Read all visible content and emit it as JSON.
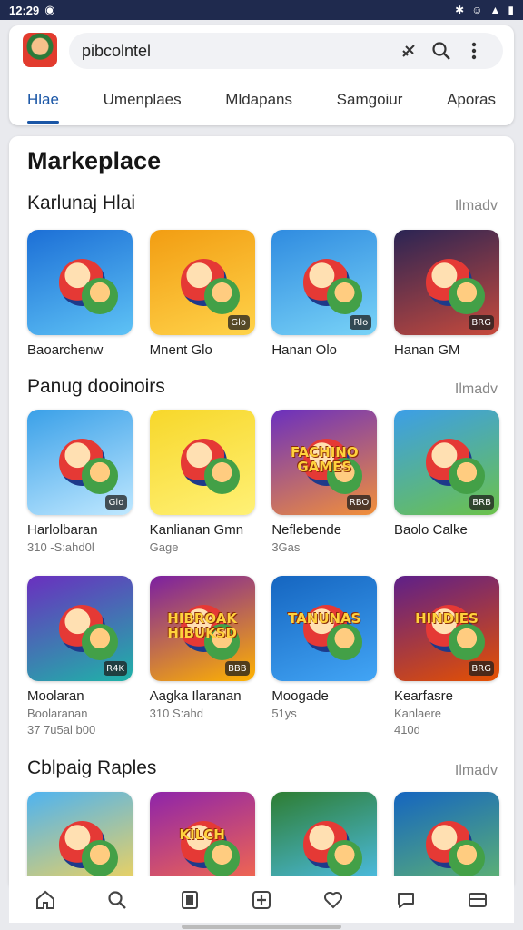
{
  "status": {
    "time": "12:29"
  },
  "search": {
    "query": "pibcolntel"
  },
  "tabs": [
    {
      "label": "Hlae",
      "active": true
    },
    {
      "label": "Umenplaes",
      "active": false
    },
    {
      "label": "Mldapans",
      "active": false
    },
    {
      "label": "Samgoiur",
      "active": false
    },
    {
      "label": "Aporas",
      "active": false
    }
  ],
  "main": {
    "title": "Markeplace",
    "sections": [
      {
        "title": "Karlunaj Hlai",
        "link": "Ilmadv",
        "games": [
          {
            "name": "Baoarchenw",
            "sub": "",
            "badge": "",
            "colors": [
              "#1c6fd6",
              "#5ec2f5"
            ],
            "art": "green-monster"
          },
          {
            "name": "Mnent Glo",
            "sub": "",
            "badge": "Glo",
            "colors": [
              "#f29d12",
              "#ffd34a"
            ],
            "art": "bowler"
          },
          {
            "name": "Hanan Olo",
            "sub": "",
            "badge": "Rlo",
            "colors": [
              "#2f8be0",
              "#79d3f7"
            ],
            "art": "duo"
          },
          {
            "name": "Hanan GM",
            "sub": "",
            "badge": "BRG",
            "colors": [
              "#2a2454",
              "#c74a3c"
            ],
            "art": "robot"
          }
        ]
      },
      {
        "title": "Panug dooinoirs",
        "link": "Ilmadv",
        "games": [
          {
            "name": "Harlolbaran",
            "sub": "310 -S:ahd0l",
            "badge": "Glo",
            "colors": [
              "#3aa0e8",
              "#bfe8ff"
            ],
            "art": "kids"
          },
          {
            "name": "Kanlianan Gmn",
            "sub": "Gage",
            "badge": "",
            "colors": [
              "#f7d72a",
              "#fff176"
            ],
            "art": "rocket-cat"
          },
          {
            "name": "Neflebende",
            "sub": "3Gas",
            "badge": "RBO",
            "colors": [
              "#6a2fbf",
              "#f2903a"
            ],
            "art": "fachino",
            "word": "FACHINO GAMES"
          },
          {
            "name": "Baolo Calke",
            "sub": "",
            "badge": "BRB",
            "colors": [
              "#3c9ee8",
              "#6cc24a"
            ],
            "art": "hammer"
          }
        ]
      },
      {
        "title": "",
        "link": "",
        "games": [
          {
            "name": "Moolaran",
            "sub": "37 7u5al b00",
            "secondary": "Boolaranan",
            "badge": "R4K",
            "colors": [
              "#6a2fbf",
              "#1fb3a8"
            ],
            "art": "red-bot"
          },
          {
            "name": "Aagka Ilaranan",
            "sub": "310 S:ahd",
            "secondary": "",
            "badge": "BBB",
            "colors": [
              "#7b1fa2",
              "#ffb300"
            ],
            "art": "hibroak",
            "word": "HIBROAK HIBUKSD"
          },
          {
            "name": "Moogade",
            "sub": "51ys",
            "secondary": "",
            "badge": "",
            "colors": [
              "#1565c0",
              "#42a5f5"
            ],
            "art": "tanunas",
            "word": "TANUNAS"
          },
          {
            "name": "Kearfasre",
            "sub": "410d",
            "secondary": "Kanlaere",
            "badge": "BRG",
            "colors": [
              "#5d1f8a",
              "#e65100"
            ],
            "art": "hindies",
            "word": "HINDIES"
          }
        ]
      },
      {
        "title": "Cblpaig Raples",
        "link": "Ilmadv",
        "games": [
          {
            "name": "",
            "sub": "",
            "badge": "",
            "colors": [
              "#4fb3f0",
              "#ffd54f"
            ],
            "art": "fox"
          },
          {
            "name": "",
            "sub": "",
            "badge": "",
            "colors": [
              "#8e24aa",
              "#ff7043"
            ],
            "art": "kilch",
            "word": "KILCH"
          },
          {
            "name": "",
            "sub": "",
            "badge": "",
            "colors": [
              "#2e7d32",
              "#4fc3f7"
            ],
            "art": "bear"
          },
          {
            "name": "",
            "sub": "",
            "badge": "",
            "colors": [
              "#1565c0",
              "#66bb6a"
            ],
            "art": "goblins"
          }
        ]
      }
    ]
  },
  "nav": [
    "home-icon",
    "search-icon",
    "library-icon",
    "add-icon",
    "heart-icon",
    "chat-icon",
    "wallet-icon"
  ]
}
